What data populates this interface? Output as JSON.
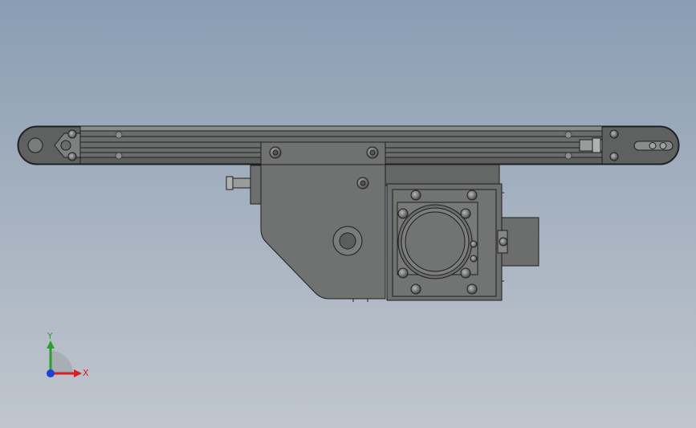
{
  "scene": {
    "view": "front view",
    "background_top": "#8a9db3",
    "background_bottom": "#c0c6cd",
    "model_color": "#6f7070",
    "model_edge_color": "#1f1f1f",
    "bolt_color": "#8d8e8e"
  },
  "triad": {
    "x_label": "X",
    "y_label": "Y",
    "x_color": "#d42020",
    "y_color": "#2aa02a",
    "z_color": "#2040d8"
  }
}
